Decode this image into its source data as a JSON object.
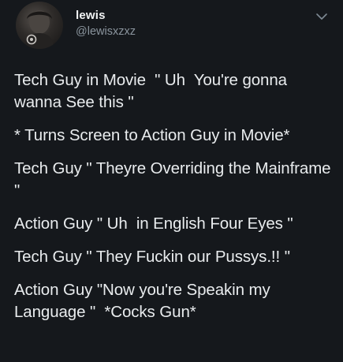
{
  "author": {
    "name": "lewis",
    "handle": "@lewisxzxz"
  },
  "icons": {
    "avatar": "profile-photo",
    "menu": "chevron-down-icon"
  },
  "colors": {
    "background": "#15181c",
    "text": "#e9ecee",
    "muted": "#8a949d"
  },
  "tweet": {
    "lines": [
      "Tech Guy in Movie  \" Uh  You're gonna wanna See this \"",
      "* Turns Screen to Action Guy in Movie*",
      "Tech Guy \" Theyre Overriding the Mainframe \"",
      "Action Guy \" Uh  in English Four Eyes \"",
      "Tech Guy \" They Fuckin our Pussys.!! \"",
      "Action Guy \"Now you're Speakin my Language \"  *Cocks Gun*"
    ]
  }
}
